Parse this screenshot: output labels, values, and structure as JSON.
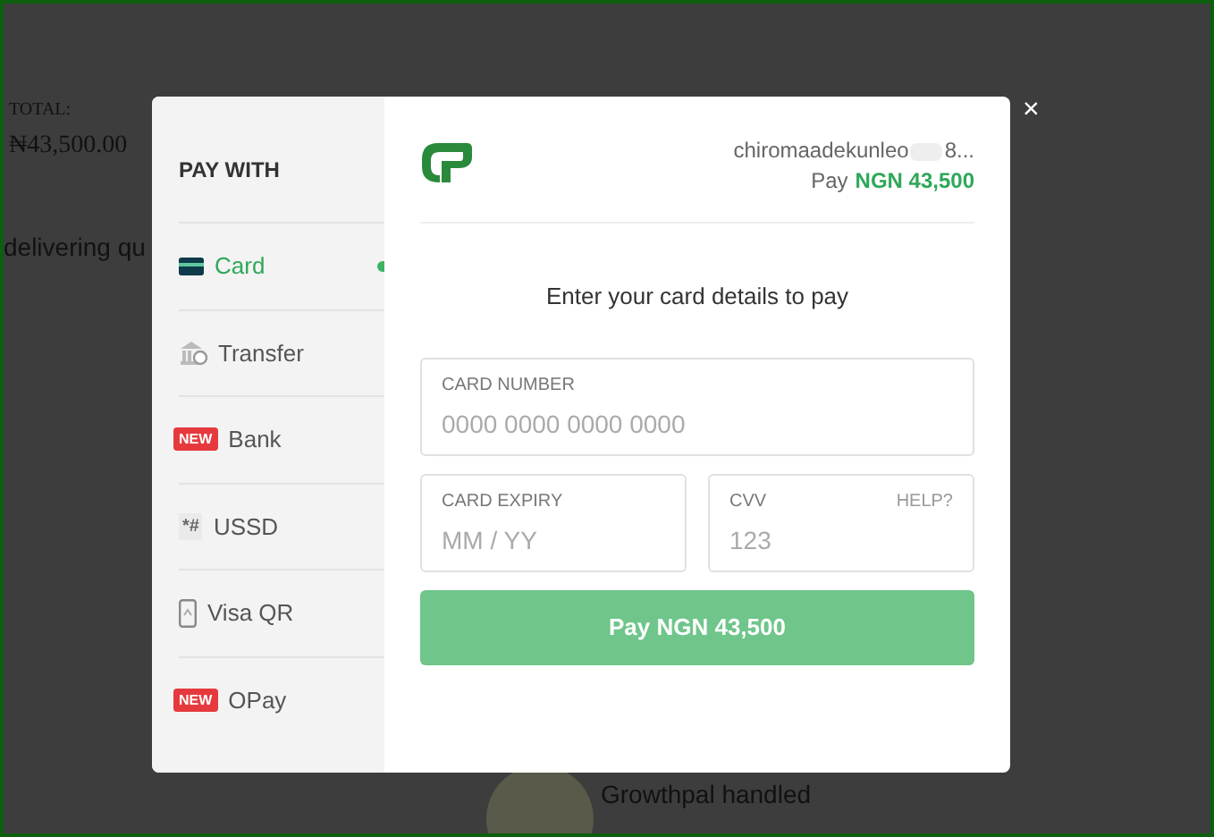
{
  "page": {
    "total_label": "TOTAL:",
    "total_amount": "₦43,500.00",
    "tagline": "delivering qu",
    "testimonial_lines": [
      "Growthpal handled"
    ]
  },
  "sidebar": {
    "title": "PAY WITH",
    "methods": [
      {
        "kind": "card",
        "label": "Card",
        "selected": true
      },
      {
        "kind": "transfer",
        "label": "Transfer",
        "selected": false
      },
      {
        "kind": "bank",
        "label": "Bank",
        "badge": "NEW",
        "selected": false
      },
      {
        "kind": "ussd",
        "label": "USSD",
        "icon_text": "*#",
        "selected": false
      },
      {
        "kind": "visa_qr",
        "label": "Visa QR",
        "selected": false
      },
      {
        "kind": "opay",
        "label": "OPay",
        "badge": "NEW",
        "selected": false
      }
    ]
  },
  "header": {
    "email_start": "chiromaadekunleo",
    "email_end": "8...",
    "pay_label": "Pay",
    "pay_amount": "NGN 43,500"
  },
  "form": {
    "heading": "Enter your card details to pay",
    "card_number": {
      "label": "CARD NUMBER",
      "placeholder": "0000 0000 0000 0000"
    },
    "expiry": {
      "label": "CARD EXPIRY",
      "placeholder": "MM / YY"
    },
    "cvv": {
      "label": "CVV",
      "help": "HELP?",
      "placeholder": "123"
    },
    "submit": "Pay NGN 43,500"
  },
  "close": "×"
}
